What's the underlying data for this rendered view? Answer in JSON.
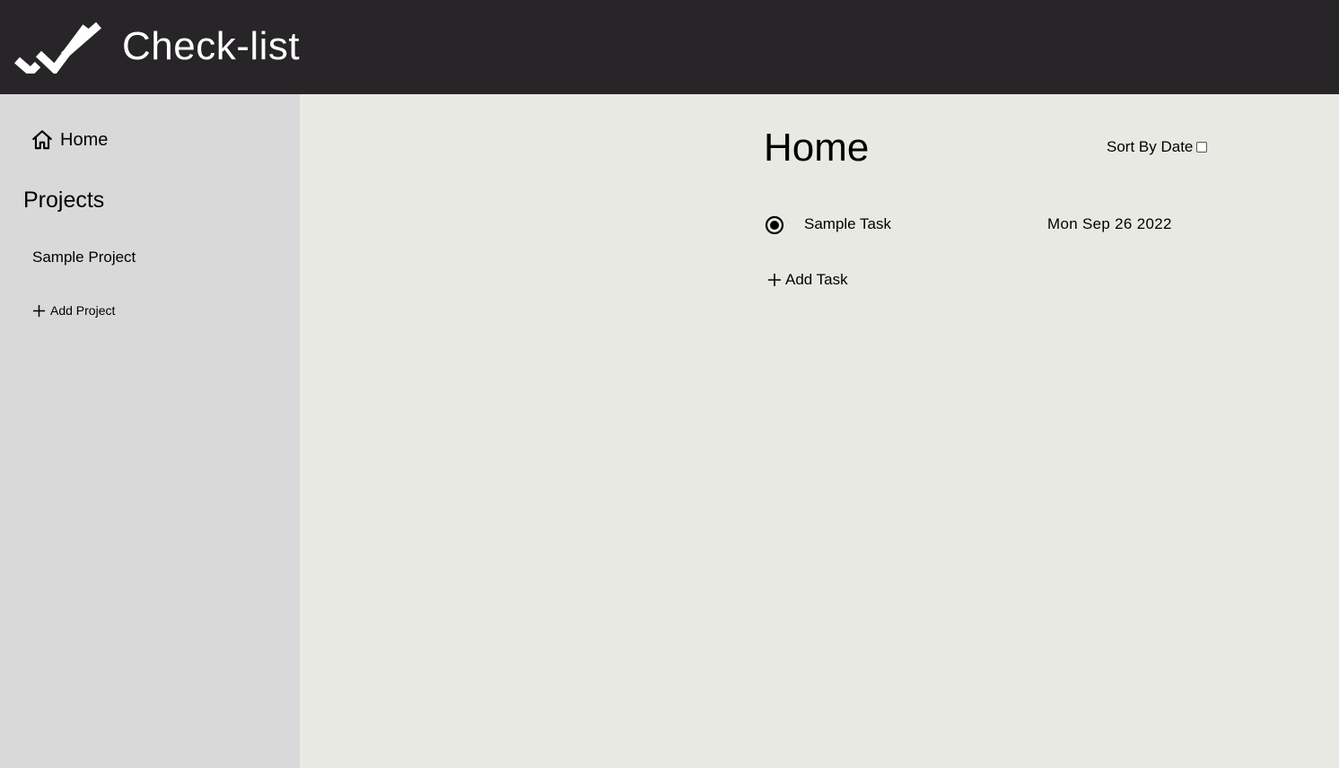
{
  "header": {
    "logo_icon": "double-check-icon",
    "title": "Check-list",
    "background": "#272527"
  },
  "sidebar": {
    "home": {
      "icon": "home-icon",
      "label": "Home"
    },
    "projects_heading": "Projects",
    "projects": [
      {
        "label": "Sample Project"
      }
    ],
    "add_project": {
      "icon": "plus-icon",
      "label": "Add Project"
    },
    "background": "#d9d9d9"
  },
  "main": {
    "title": "Home",
    "sort": {
      "label": "Sort By Date",
      "checked": false
    },
    "tasks": [
      {
        "name": "Sample Task",
        "date": "Mon Sep 26 2022",
        "selected": true
      }
    ],
    "add_task": {
      "icon": "plus-icon",
      "label": "Add Task"
    },
    "background": "#e9e9e4"
  }
}
